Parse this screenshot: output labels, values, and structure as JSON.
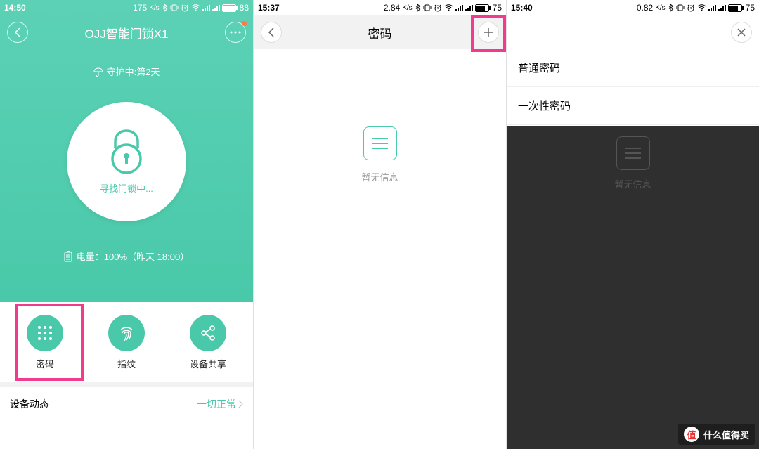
{
  "pane1": {
    "status": {
      "time": "14:50",
      "speed": "175",
      "unit": "K/s",
      "battery": "88"
    },
    "title": "OJJ智能门锁X1",
    "guard": "守护中:第2天",
    "lockStatus": "寻找门锁中...",
    "batteryLine": "电量：100%（昨天 18:00）",
    "actions": [
      {
        "label": "密码"
      },
      {
        "label": "指纹"
      },
      {
        "label": "设备共享"
      }
    ],
    "dynamic": {
      "label": "设备动态",
      "status": "一切正常"
    }
  },
  "pane2": {
    "status": {
      "time": "15:37",
      "speed": "2.84",
      "unit": "K/s",
      "battery": "75"
    },
    "title": "密码",
    "empty": "暂无信息"
  },
  "pane3": {
    "status": {
      "time": "15:40",
      "speed": "0.82",
      "unit": "K/s",
      "battery": "75"
    },
    "options": [
      {
        "label": "普通密码"
      },
      {
        "label": "一次性密码"
      }
    ],
    "ghost": "暂无信息"
  },
  "watermark": {
    "badge": "值",
    "text": "什么值得买"
  }
}
